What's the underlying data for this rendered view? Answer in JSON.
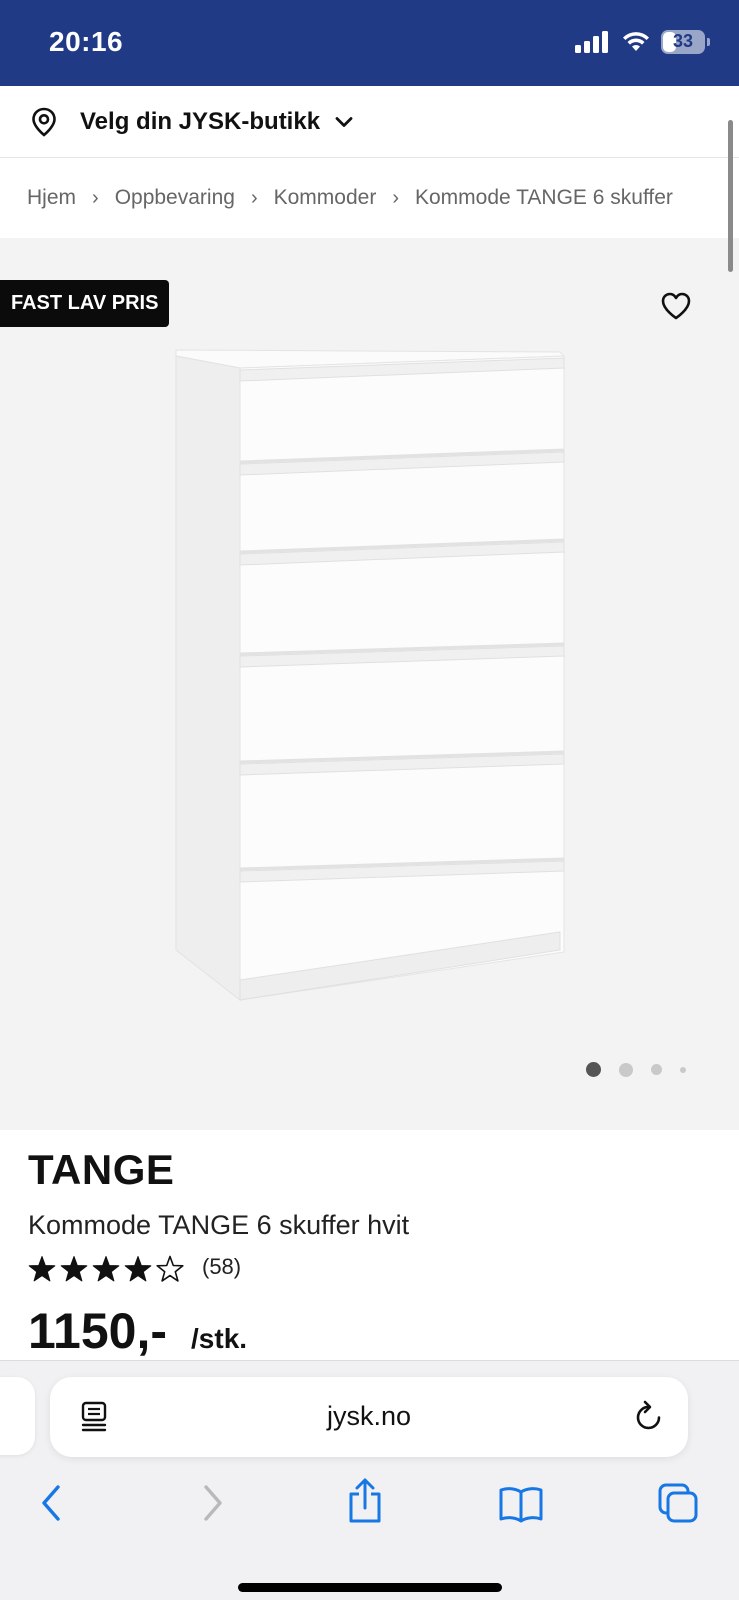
{
  "status_bar": {
    "time": "20:16",
    "battery": "33",
    "battery_level": 0.33
  },
  "store": {
    "label": "Velg din JYSK-butikk",
    "icon": "location-pin-icon"
  },
  "breadcrumb": [
    "Hjem",
    "Oppbevaring",
    "Kommoder",
    "Kommode TANGE 6 skuffer"
  ],
  "gallery": {
    "badge": "FAST LAV PRIS",
    "current_image": 1,
    "total_dots": 4
  },
  "product": {
    "brand": "TANGE",
    "name": "Kommode TANGE 6 skuffer hvit",
    "rating": 4,
    "rating_max": 5,
    "reviews": "(58)",
    "price": "1150,-",
    "unit": "/stk."
  },
  "browser": {
    "url": "jysk.no"
  },
  "colors": {
    "header_bg": "#213a86",
    "badge_bg": "#0b0b0b",
    "safari_blue": "#1677e5"
  }
}
